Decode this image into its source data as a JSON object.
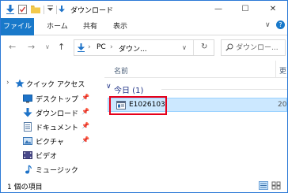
{
  "window": {
    "title": "ダウンロード",
    "controls": {
      "minimize": "—",
      "maximize": "☐",
      "close": "✕"
    },
    "accent": "#1979ca"
  },
  "ribbon": {
    "tabs": [
      {
        "label": "ファイル",
        "active": true
      },
      {
        "label": "ホーム"
      },
      {
        "label": "共有"
      },
      {
        "label": "表示"
      }
    ],
    "expand_glyph": "∨",
    "help_glyph": "?"
  },
  "address": {
    "back": "←",
    "forward": "→",
    "recent": "∨",
    "up": "↑",
    "breadcrumb": [
      "PC",
      "ダウン..."
    ],
    "separator": "›",
    "dropdown": "∨",
    "refresh": "↻",
    "search_placeholder": "ダウンロー..."
  },
  "navpane": {
    "quick_access": {
      "chevron": "›",
      "label": "クイック アクセス"
    },
    "items": [
      {
        "label": "デスクトップ",
        "icon": "desktop-icon",
        "pinned": true
      },
      {
        "label": "ダウンロード",
        "icon": "download-icon",
        "pinned": true
      },
      {
        "label": "ドキュメント",
        "icon": "document-icon",
        "pinned": true
      },
      {
        "label": "ピクチャ",
        "icon": "picture-icon",
        "pinned": true
      },
      {
        "label": "ビデオ",
        "icon": "video-icon",
        "pinned": false
      },
      {
        "label": "ミュージック",
        "icon": "music-icon",
        "pinned": false
      }
    ]
  },
  "content": {
    "columns": {
      "name": "名前",
      "date": "更"
    },
    "group": {
      "chevron": "∨",
      "label": "今日 (1)"
    },
    "files": [
      {
        "name": "E1026103",
        "date": "20",
        "icon": "file-icon",
        "selected": true,
        "highlight_color": "#e6001a"
      }
    ]
  },
  "status": {
    "text": "1 個の項目"
  }
}
